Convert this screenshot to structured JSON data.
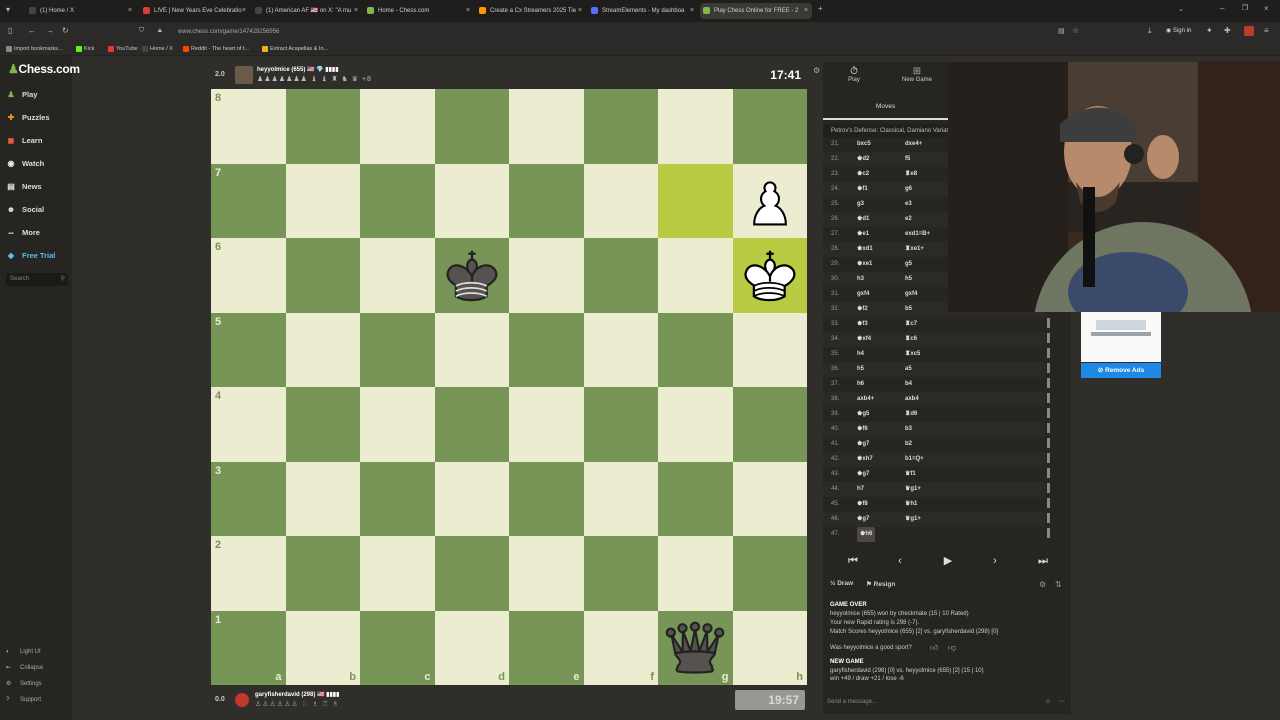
{
  "browser": {
    "tabs": [
      {
        "label": "(1) Home / X",
        "color": "#444",
        "icon": "x-icon"
      },
      {
        "label": "LIVE | New Years Eve Celebratio",
        "color": "#e53935",
        "icon": "youtube-icon"
      },
      {
        "label": "(1) American AF 🇺🇸 on X: \"A mu",
        "color": "#444",
        "icon": "x-icon"
      },
      {
        "label": "Home - Chess.com",
        "color": "#81b64c",
        "icon": "chess-icon"
      },
      {
        "label": "Create a Cx Streamers 2025 Tie",
        "color": "#ff9800",
        "icon": "tier-icon"
      },
      {
        "label": "StreamElements - My dashboa",
        "color": "#5b6cff",
        "icon": "se-icon"
      },
      {
        "label": "Play Chess Online for FREE - 2",
        "color": "#81b64c",
        "icon": "chess-icon"
      }
    ],
    "url": "www.chess.com/game/147429256956",
    "sign_in": "Sign in",
    "bookmarks": [
      {
        "label": "Import bookmarks...",
        "color": "#888"
      },
      {
        "label": "Kick",
        "color": "#53fc18"
      },
      {
        "label": "YouTube",
        "color": "#e53935"
      },
      {
        "label": "Home / X",
        "color": "#444"
      },
      {
        "label": "Reddit - The heart of t...",
        "color": "#ff4500"
      },
      {
        "label": "Extract Acapellas & In...",
        "color": "#f2b01e"
      }
    ]
  },
  "sidebar": {
    "logo": "Chess.com",
    "items": [
      {
        "label": "Play",
        "icon": "play-icon",
        "color": "#81b64c"
      },
      {
        "label": "Puzzles",
        "icon": "puzzle-icon",
        "color": "#f08c2c"
      },
      {
        "label": "Learn",
        "icon": "learn-icon",
        "color": "#e65a3e"
      },
      {
        "label": "Watch",
        "icon": "watch-icon",
        "color": "#e8e6e3"
      },
      {
        "label": "News",
        "icon": "news-icon",
        "color": "#e8e6e3"
      },
      {
        "label": "Social",
        "icon": "social-icon",
        "color": "#e8e6e3"
      },
      {
        "label": "More",
        "icon": "more-icon",
        "color": "#e8e6e3"
      },
      {
        "label": "Free Trial",
        "icon": "diamond-icon",
        "color": "#5bc0eb"
      }
    ],
    "search_placeholder": "Search",
    "footer": [
      {
        "label": "Light UI",
        "icon": "light-icon"
      },
      {
        "label": "Collapse",
        "icon": "collapse-icon"
      },
      {
        "label": "Settings",
        "icon": "settings-icon"
      },
      {
        "label": "Support",
        "icon": "support-icon"
      }
    ]
  },
  "game": {
    "top_player": {
      "name": "heyyolmice (655) 🇺🇸 💎 ▮▮▮▮",
      "score": "2.0",
      "clock": "17:41",
      "captures": "♟♟♟♟♟♟♟ ♝ ♝ ♜ ♞ ♛ +8"
    },
    "bottom_player": {
      "name": "garyfisherdavid (298) 🇺🇸 ▮▮▮▮",
      "score": "0.0",
      "clock": "19:57",
      "captures": "♙♙♙♙♙♙ ♘ ♗ ♖ ♗"
    },
    "files": [
      "a",
      "b",
      "c",
      "d",
      "e",
      "f",
      "g",
      "h"
    ],
    "ranks": [
      "8",
      "7",
      "6",
      "5",
      "4",
      "3",
      "2",
      "1"
    ],
    "highlight": [
      "g7",
      "h6"
    ],
    "pieces": [
      {
        "square": "h7",
        "type": "pawn",
        "color": "white"
      },
      {
        "square": "d6",
        "type": "king",
        "color": "black"
      },
      {
        "square": "h6",
        "type": "king",
        "color": "white"
      },
      {
        "square": "g1",
        "type": "queen",
        "color": "black"
      }
    ]
  },
  "panel": {
    "tabs": [
      {
        "label": "Play",
        "icon": "stopwatch-icon"
      },
      {
        "label": "New Game",
        "icon": "plus-icon"
      }
    ],
    "moves_label": "Moves",
    "opening": "Petrov's Defense: Classical, Damiano Variation",
    "moves": [
      {
        "n": "21.",
        "w": "bxc5",
        "b": "dxe4+"
      },
      {
        "n": "22.",
        "w": "♚d2",
        "b": "f5"
      },
      {
        "n": "23.",
        "w": "♚c2",
        "b": "♜e8"
      },
      {
        "n": "24.",
        "w": "♚f1",
        "b": "g6"
      },
      {
        "n": "25.",
        "w": "g3",
        "b": "e3"
      },
      {
        "n": "26.",
        "w": "♚d1",
        "b": "e2"
      },
      {
        "n": "27.",
        "w": "♚e1",
        "b": "exd1=B+"
      },
      {
        "n": "28.",
        "w": "♚xd1",
        "b": "♜xe1+"
      },
      {
        "n": "29.",
        "w": "♚xe1",
        "b": "g5"
      },
      {
        "n": "30.",
        "w": "h3",
        "b": "h5"
      },
      {
        "n": "31.",
        "w": "gxf4",
        "b": "gxf4"
      },
      {
        "n": "32.",
        "w": "♚f2",
        "b": "b5"
      },
      {
        "n": "33.",
        "w": "♚f3",
        "b": "♜c7"
      },
      {
        "n": "34.",
        "w": "♚xf4",
        "b": "♜c6"
      },
      {
        "n": "35.",
        "w": "h4",
        "b": "♜xc5"
      },
      {
        "n": "36.",
        "w": "h5",
        "b": "a5"
      },
      {
        "n": "37.",
        "w": "h6",
        "b": "b4"
      },
      {
        "n": "38.",
        "w": "axb4+",
        "b": "axb4"
      },
      {
        "n": "39.",
        "w": "♚g5",
        "b": "♜d6"
      },
      {
        "n": "40.",
        "w": "♚f6",
        "b": "b3"
      },
      {
        "n": "41.",
        "w": "♚g7",
        "b": "b2"
      },
      {
        "n": "42.",
        "w": "♚xh7",
        "b": "b1=Q+"
      },
      {
        "n": "43.",
        "w": "♚g7",
        "b": "♛f1"
      },
      {
        "n": "44.",
        "w": "h7",
        "b": "♛g1+"
      },
      {
        "n": "45.",
        "w": "♚f8",
        "b": "♛h1"
      },
      {
        "n": "46.",
        "w": "♚g7",
        "b": "♛g1+"
      },
      {
        "n": "47.",
        "w": "♚h6",
        "b": ""
      }
    ],
    "draw_label": "Draw",
    "resign_label": "Resign",
    "chat": {
      "game_over": "GAME OVER",
      "result": "heyyolmice (655) won by checkmate (15 | 10 Rated)",
      "rating": "Your new Rapid rating is 298 (-7).",
      "match": "Match Scores heyyolmice (655) [2] vs. garyfisherdavid (298) [0]",
      "sport": "Was heyyolmice a good sport?",
      "new_game": "NEW GAME",
      "new_game_line": "garyfisherdavid (298) [0] vs. heyyolmice (655) [2] (15 | 10)",
      "record": "win +49 / draw +21 / lose -6"
    },
    "message_placeholder": "Send a message..."
  },
  "ad": {
    "remove_ads": "Remove Ads"
  }
}
